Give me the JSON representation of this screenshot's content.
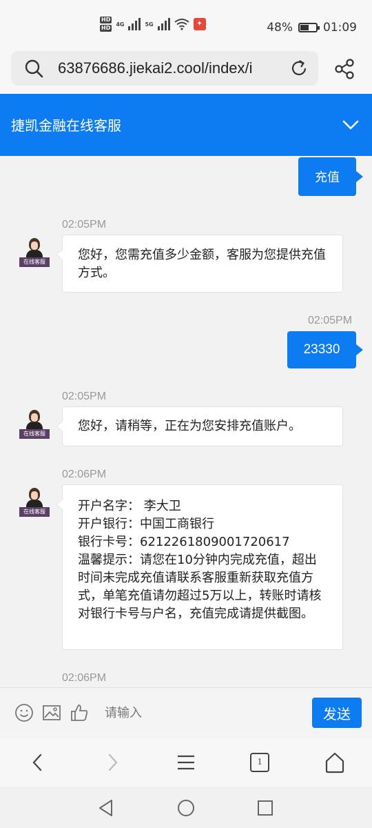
{
  "status_bar": {
    "net_1": "4G",
    "net_2": "5G",
    "battery_percent": "48%",
    "battery_level": 0.48,
    "time": "01:09"
  },
  "browser": {
    "url": "63876686.jiekai2.cool/index/i"
  },
  "header": {
    "title": "捷凯金融在线客服"
  },
  "agent": {
    "avatar_label": "在线客服"
  },
  "messages": [
    {
      "side": "right",
      "text": "充值"
    },
    {
      "side": "left",
      "time": "02:05PM",
      "text": "您好，您需充值多少金额，客服为您提供充值方式。"
    },
    {
      "side": "right",
      "time": "02:05PM",
      "text": "23330"
    },
    {
      "side": "left",
      "time": "02:05PM",
      "text": "您好，请稍等，正在为您安排充值账户。"
    },
    {
      "side": "left",
      "time": "02:06PM",
      "lines": [
        "开户名字： 李大卫",
        "开户银行：中国工商银行",
        "银行卡号：6212261809001720617",
        "温馨提示：请您在10分钟内完成充值，超出时间未完成充值请联系客服重新获取充值方式，单笔充值请勿超过5万以上，转账时请核对银行卡号与户名，充值完成请提供截图。"
      ]
    },
    {
      "side": "left",
      "time": "02:06PM"
    }
  ],
  "composer": {
    "placeholder": "请输入",
    "send_label": "发送"
  },
  "browser_nav": {
    "tab_count": "1"
  },
  "icons": {
    "url_bar": [
      "search-icon",
      "reload-icon",
      "share-icon"
    ],
    "header": [
      "chevron-down-icon"
    ],
    "composer": [
      "emoji-icon",
      "image-icon",
      "thumbs-up-icon"
    ],
    "browser_nav": [
      "back-icon",
      "forward-icon",
      "menu-icon",
      "tabs-icon",
      "home-icon"
    ],
    "system_nav": [
      "system-back-icon",
      "system-home-icon",
      "system-recents-icon"
    ]
  },
  "colors": {
    "accent": "#0d7cf2",
    "background": "#f2f2f2"
  }
}
